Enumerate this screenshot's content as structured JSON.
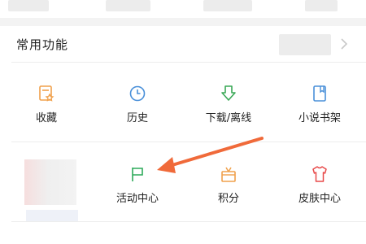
{
  "section": {
    "title": "常用功能"
  },
  "functions": [
    {
      "label": "收藏",
      "icon": "favorites-icon",
      "color": "#f0a04b"
    },
    {
      "label": "历史",
      "icon": "history-clock-icon",
      "color": "#4a90d9"
    },
    {
      "label": "下载/离线",
      "icon": "download-icon",
      "color": "#3aa857"
    },
    {
      "label": "小说书架",
      "icon": "bookshelf-icon",
      "color": "#4a90d9"
    },
    {
      "label": "活动中心",
      "icon": "flag-icon",
      "color": "#2daa5a"
    },
    {
      "label": "积分",
      "icon": "gift-box-icon",
      "color": "#f0a04b"
    },
    {
      "label": "皮肤中心",
      "icon": "shirt-icon",
      "color": "#e84a4a"
    }
  ],
  "annotation": {
    "arrow_color": "#f06a3a"
  }
}
